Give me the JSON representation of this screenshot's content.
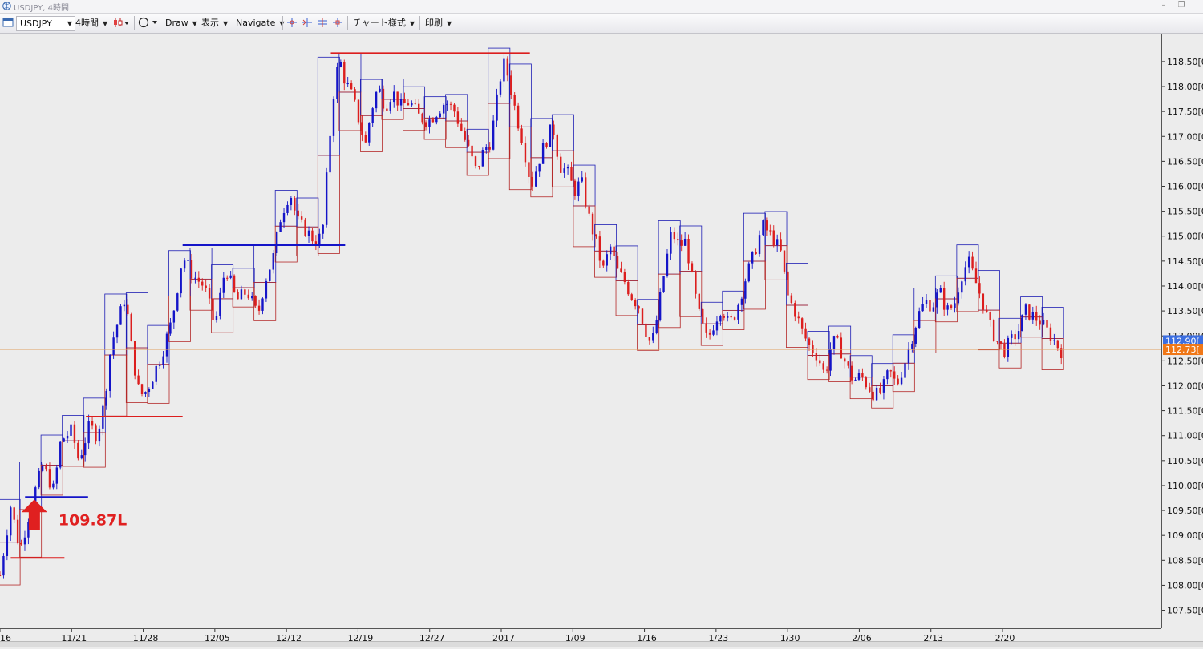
{
  "window": {
    "title": "USDJPY, 4時間"
  },
  "window_controls": {
    "minimize": "–",
    "restore": "❐"
  },
  "toolbar": {
    "symbol": "USDJPY",
    "timeframe": "4時間",
    "draw": "Draw",
    "display": "表示",
    "navigate": "Navigate",
    "chart_style": "チャート様式",
    "print": "印刷"
  },
  "colors": {
    "bull": "#1414c8",
    "bear": "#dc1e1e",
    "box_high": "#1e1eb4",
    "box_low": "#b42828",
    "price_line": "#e0a060",
    "current_price_bg": "#f07818",
    "ask_price_bg": "#3c6ee0",
    "annotation": "#e02020"
  },
  "icons": [
    "app-globe-icon",
    "candlestick-icon",
    "ellipse-icon",
    "crosshair-icon",
    "dropdown-arrow-icon",
    "up-arrow-icon"
  ],
  "annotation": {
    "label": "109.87L"
  },
  "chart_data": {
    "type": "candlestick",
    "symbol": "USDJPY",
    "timeframe": "4時間",
    "y_range": [
      107.3,
      118.9
    ],
    "y_ticks": [
      {
        "value": 118.5,
        "label": "118.50[0"
      },
      {
        "value": 118.0,
        "label": "118.00[0"
      },
      {
        "value": 117.5,
        "label": "117.50[0"
      },
      {
        "value": 117.0,
        "label": "117.00[0"
      },
      {
        "value": 116.5,
        "label": "116.50[0"
      },
      {
        "value": 116.0,
        "label": "116.00[0"
      },
      {
        "value": 115.5,
        "label": "115.50[0"
      },
      {
        "value": 115.0,
        "label": "115.00[0"
      },
      {
        "value": 114.5,
        "label": "114.50[0"
      },
      {
        "value": 114.0,
        "label": "114.00[0"
      },
      {
        "value": 113.5,
        "label": "113.50[0"
      },
      {
        "value": 113.0,
        "label": "113.00[0"
      },
      {
        "value": 112.5,
        "label": "112.50[0"
      },
      {
        "value": 112.0,
        "label": "112.00[0"
      },
      {
        "value": 111.5,
        "label": "111.50[0"
      },
      {
        "value": 111.0,
        "label": "111.00[0"
      },
      {
        "value": 110.5,
        "label": "110.50[0"
      },
      {
        "value": 110.0,
        "label": "110.00[0"
      },
      {
        "value": 109.5,
        "label": "109.50[0"
      },
      {
        "value": 109.0,
        "label": "109.00[0"
      },
      {
        "value": 108.5,
        "label": "108.50[0"
      },
      {
        "value": 108.0,
        "label": "108.00[0"
      },
      {
        "value": 107.5,
        "label": "107.50[0"
      }
    ],
    "x_ticks": [
      {
        "label": "16",
        "x": 0
      },
      {
        "label": "11/21",
        "x": 1
      },
      {
        "label": "11/28",
        "x": 2
      },
      {
        "label": "12/05",
        "x": 3
      },
      {
        "label": "12/12",
        "x": 4
      },
      {
        "label": "12/19",
        "x": 5
      },
      {
        "label": "12/27",
        "x": 6
      },
      {
        "label": "2017",
        "x": 7
      },
      {
        "label": "1/09",
        "x": 8
      },
      {
        "label": "1/16",
        "x": 9
      },
      {
        "label": "1/23",
        "x": 10
      },
      {
        "label": "1/30",
        "x": 11
      },
      {
        "label": "2/06",
        "x": 12
      },
      {
        "label": "2/13",
        "x": 13
      },
      {
        "label": "2/20",
        "x": 14
      }
    ],
    "price_path": [
      [
        0.0,
        108.2
      ],
      [
        0.15,
        109.6
      ],
      [
        0.28,
        108.7
      ],
      [
        0.45,
        109.7
      ],
      [
        0.6,
        110.4
      ],
      [
        0.75,
        109.9
      ],
      [
        0.85,
        110.9
      ],
      [
        1.0,
        111.1
      ],
      [
        1.1,
        110.5
      ],
      [
        1.25,
        111.2
      ],
      [
        1.35,
        111.0
      ],
      [
        1.45,
        111.6
      ],
      [
        1.55,
        112.8
      ],
      [
        1.65,
        113.3
      ],
      [
        1.75,
        113.8
      ],
      [
        1.85,
        112.6
      ],
      [
        1.95,
        111.8
      ],
      [
        2.05,
        111.9
      ],
      [
        2.25,
        112.6
      ],
      [
        2.4,
        113.3
      ],
      [
        2.55,
        114.6
      ],
      [
        2.7,
        114.2
      ],
      [
        2.85,
        114.0
      ],
      [
        3.0,
        113.2
      ],
      [
        3.15,
        114.4
      ],
      [
        3.3,
        113.7
      ],
      [
        3.45,
        113.9
      ],
      [
        3.6,
        113.4
      ],
      [
        3.7,
        114.1
      ],
      [
        3.82,
        114.6
      ],
      [
        3.92,
        115.4
      ],
      [
        4.05,
        115.9
      ],
      [
        4.15,
        115.3
      ],
      [
        4.28,
        115.1
      ],
      [
        4.4,
        114.9
      ],
      [
        4.5,
        115.0
      ],
      [
        4.6,
        116.9
      ],
      [
        4.68,
        118.2
      ],
      [
        4.75,
        118.5
      ],
      [
        4.82,
        118.1
      ],
      [
        4.92,
        117.8
      ],
      [
        5.0,
        117.4
      ],
      [
        5.1,
        116.8
      ],
      [
        5.18,
        117.5
      ],
      [
        5.28,
        118.0
      ],
      [
        5.38,
        117.6
      ],
      [
        5.48,
        117.9
      ],
      [
        5.6,
        117.6
      ],
      [
        5.72,
        117.7
      ],
      [
        5.85,
        117.4
      ],
      [
        5.98,
        117.3
      ],
      [
        6.1,
        117.5
      ],
      [
        6.22,
        117.7
      ],
      [
        6.35,
        117.5
      ],
      [
        6.45,
        117.1
      ],
      [
        6.55,
        116.7
      ],
      [
        6.65,
        116.3
      ],
      [
        6.75,
        116.7
      ],
      [
        6.85,
        116.9
      ],
      [
        6.95,
        117.8
      ],
      [
        7.02,
        118.5
      ],
      [
        7.1,
        118.2
      ],
      [
        7.2,
        117.5
      ],
      [
        7.3,
        116.9
      ],
      [
        7.42,
        116.0
      ],
      [
        7.52,
        116.5
      ],
      [
        7.62,
        116.9
      ],
      [
        7.72,
        117.2
      ],
      [
        7.82,
        116.4
      ],
      [
        7.92,
        116.3
      ],
      [
        8.02,
        115.9
      ],
      [
        8.12,
        116.1
      ],
      [
        8.22,
        115.4
      ],
      [
        8.32,
        114.9
      ],
      [
        8.42,
        114.3
      ],
      [
        8.52,
        114.8
      ],
      [
        8.62,
        114.3
      ],
      [
        8.72,
        114.1
      ],
      [
        8.82,
        113.8
      ],
      [
        8.92,
        113.6
      ],
      [
        9.02,
        113.1
      ],
      [
        9.1,
        112.8
      ],
      [
        9.18,
        113.4
      ],
      [
        9.28,
        114.3
      ],
      [
        9.38,
        115.1
      ],
      [
        9.48,
        114.8
      ],
      [
        9.58,
        114.9
      ],
      [
        9.68,
        114.0
      ],
      [
        9.78,
        113.3
      ],
      [
        9.88,
        112.9
      ],
      [
        9.98,
        113.3
      ],
      [
        10.08,
        113.6
      ],
      [
        10.18,
        113.2
      ],
      [
        10.28,
        113.5
      ],
      [
        10.4,
        114.1
      ],
      [
        10.52,
        114.6
      ],
      [
        10.65,
        115.2
      ],
      [
        10.78,
        115.0
      ],
      [
        10.9,
        114.7
      ],
      [
        11.0,
        113.8
      ],
      [
        11.1,
        113.5
      ],
      [
        11.2,
        113.1
      ],
      [
        11.3,
        112.8
      ],
      [
        11.42,
        112.6
      ],
      [
        11.52,
        112.2
      ],
      [
        11.62,
        112.9
      ],
      [
        11.72,
        112.8
      ],
      [
        11.82,
        112.4
      ],
      [
        11.92,
        112.1
      ],
      [
        12.02,
        112.2
      ],
      [
        12.12,
        112.0
      ],
      [
        12.22,
        111.8
      ],
      [
        12.32,
        111.9
      ],
      [
        12.42,
        112.3
      ],
      [
        12.52,
        112.0
      ],
      [
        12.62,
        112.4
      ],
      [
        12.72,
        112.9
      ],
      [
        12.82,
        113.4
      ],
      [
        12.92,
        113.7
      ],
      [
        13.02,
        113.6
      ],
      [
        13.12,
        113.9
      ],
      [
        13.22,
        113.5
      ],
      [
        13.32,
        113.6
      ],
      [
        13.42,
        114.2
      ],
      [
        13.52,
        114.5
      ],
      [
        13.62,
        114.1
      ],
      [
        13.72,
        113.7
      ],
      [
        13.82,
        113.2
      ],
      [
        13.92,
        112.9
      ],
      [
        14.02,
        112.7
      ],
      [
        14.12,
        112.9
      ],
      [
        14.22,
        113.1
      ],
      [
        14.32,
        113.5
      ],
      [
        14.42,
        113.4
      ],
      [
        14.52,
        113.3
      ],
      [
        14.62,
        113.1
      ],
      [
        14.72,
        112.9
      ],
      [
        14.82,
        112.7
      ]
    ],
    "horizontal_lines": [
      {
        "name": "blue-level-line-109-8",
        "y": 109.77,
        "x_from": 0.35,
        "x_to": 1.23,
        "color": "#1414c8"
      },
      {
        "name": "red-level-line-108-5",
        "y": 108.55,
        "x_from": 0.15,
        "x_to": 0.9,
        "color": "#dc1e1e"
      },
      {
        "name": "red-level-line-111-4",
        "y": 111.38,
        "x_from": 1.2,
        "x_to": 2.55,
        "color": "#dc1e1e"
      },
      {
        "name": "blue-level-line-114-8",
        "y": 114.82,
        "x_from": 2.55,
        "x_to": 4.82,
        "color": "#1414c8"
      },
      {
        "name": "red-level-line-118-6",
        "y": 118.67,
        "x_from": 4.62,
        "x_to": 7.4,
        "color": "#dc1e1e"
      }
    ],
    "current_price": 112.73,
    "current_price_label": "112.73[",
    "ask_price": 112.9,
    "ask_price_label": "112.90[",
    "grid": false,
    "legend": "none"
  }
}
